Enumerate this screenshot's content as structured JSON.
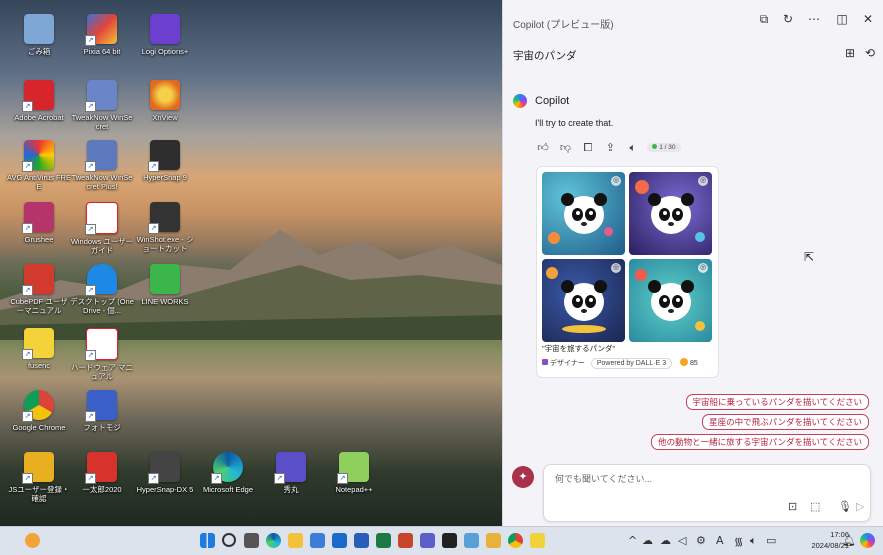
{
  "desktop": {
    "icons": [
      {
        "label": "ごみ箱"
      },
      {
        "label": "Pixia 64 bit"
      },
      {
        "label": "Logi Options+"
      },
      {
        "label": "Adobe Acrobat"
      },
      {
        "label": "TweakNow WinSecret"
      },
      {
        "label": "XnView"
      },
      {
        "label": "AVG AntiVirus FREE"
      },
      {
        "label": "TweakNow WinSecret Plus!"
      },
      {
        "label": "HyperSnap 9"
      },
      {
        "label": "Grushee"
      },
      {
        "label": "Windows ユーザー ガイド"
      },
      {
        "label": "WinShot.exe - ショートカット"
      },
      {
        "label": "CubePDF ユーザーマニュアル"
      },
      {
        "label": "デスクトップ (OneDrive - 個..."
      },
      {
        "label": "LINE WORKS"
      },
      {
        "label": "fusenc"
      },
      {
        "label": "ハードウェア マニュアル"
      },
      {
        "label": "Google Chrome"
      },
      {
        "label": "フォトモジ"
      },
      {
        "label": "JSユーザー登録・確認"
      },
      {
        "label": "一太郎2020"
      },
      {
        "label": "HyperSnap-DX 5"
      },
      {
        "label": "Microsoft Edge"
      },
      {
        "label": "秀丸"
      },
      {
        "label": "Notepad++"
      }
    ]
  },
  "taskbar": {
    "clock_time": "17:06",
    "clock_date": "2024/08/21"
  },
  "copilot": {
    "title": "Copilot (プレビュー版)",
    "conversation_title": "宇宙のパンダ",
    "sender": "Copilot",
    "message": "I'll try to create that.",
    "counter": "1 / 30",
    "image_caption": "\"宇宙を旅するパンダ\"",
    "designer_label": "デザイナー",
    "powered_by": "Powered by DALL·E 3",
    "coins": "85",
    "suggestions": [
      "宇宙船に乗っているパンダを描いてください",
      "星座の中で飛ぶパンダを描いてください",
      "他の動物と一緒に旅する宇宙パンダを描いてください"
    ],
    "input_placeholder": "何でも聞いてください..."
  },
  "colors": {
    "accent": "#b5273f",
    "panel_bg": "#f4f4f8",
    "taskbar_bg": "#dde3ec"
  }
}
